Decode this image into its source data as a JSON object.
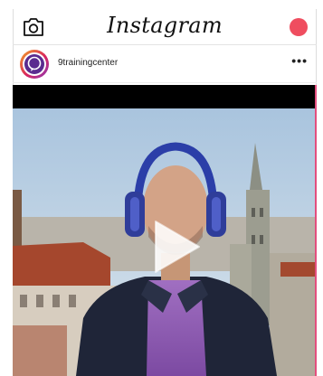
{
  "app": {
    "title": "Instagram"
  },
  "post": {
    "username": "9trainingcenter",
    "more_label": "•••"
  },
  "icons": {
    "camera": "camera-icon",
    "record": "record-button",
    "more": "more-options-icon",
    "play": "play-icon"
  },
  "colors": {
    "record": "#ef4d5f",
    "avatar_ring_start": "#f5a623",
    "avatar_ring_end": "#8a3ab9",
    "avatar_core": "#5a2b8f"
  }
}
